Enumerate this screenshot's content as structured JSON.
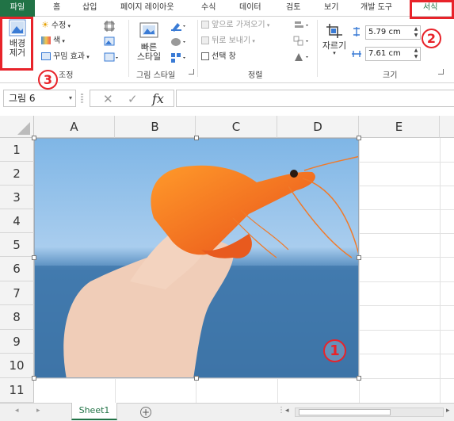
{
  "tabs": [
    "파일",
    "홈",
    "삽입",
    "페이지 레이아웃",
    "수식",
    "데이터",
    "검토",
    "보기",
    "개발 도구",
    "서식"
  ],
  "ribbon": {
    "remove_bg": [
      "배경",
      "제거"
    ],
    "adjust": {
      "corrections": "수정",
      "color": "색",
      "artistic": "꾸밈 효과",
      "label": "조정"
    },
    "picture_styles": {
      "quick_styles": [
        "빠른",
        "스타일"
      ],
      "label": "그림 스타일"
    },
    "arrange": {
      "bring_forward": "앞으로 가져오기",
      "send_backward": "뒤로 보내기",
      "selection_pane": "선택 창",
      "label": "정렬"
    },
    "size": {
      "crop": "자르기",
      "height": "5.79 cm",
      "width": "7.61 cm",
      "label": "크기"
    }
  },
  "formula_bar": {
    "name_box": "그림 6",
    "fx": "fx",
    "value": ""
  },
  "columns": [
    "A",
    "B",
    "C",
    "D",
    "E"
  ],
  "rows": [
    "1",
    "2",
    "3",
    "4",
    "5",
    "6",
    "7",
    "8",
    "9",
    "10",
    "11"
  ],
  "sheet_tab": "Sheet1",
  "annotations": {
    "badge1": "1",
    "badge2": "2",
    "badge3": "3"
  },
  "colors": {
    "file_tab": "#217346",
    "highlight": "#e8232a"
  }
}
